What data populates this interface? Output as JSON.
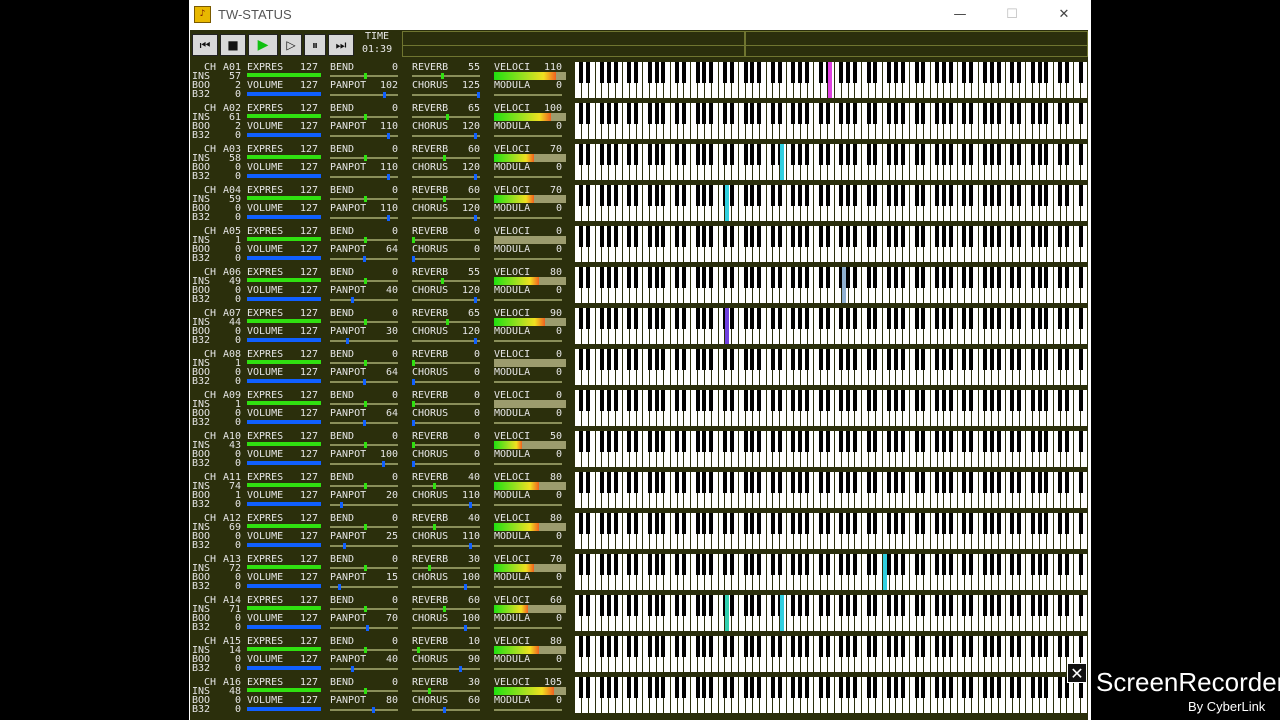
{
  "window": {
    "title": "TW-STATUS",
    "icon": "tw-app-icon",
    "minimize": "—",
    "maximize": "☐",
    "close": "✕"
  },
  "toolbar": {
    "buttons": [
      {
        "name": "skip-back-button",
        "icon": "skip-back-icon",
        "label": "⏮"
      },
      {
        "name": "stop-button",
        "icon": "stop-icon",
        "label": "■"
      },
      {
        "name": "play-button",
        "icon": "play-icon",
        "label": "▶"
      },
      {
        "name": "step-forward-button",
        "icon": "step-forward-icon",
        "label": "▷"
      },
      {
        "name": "pause-button",
        "icon": "pause-icon",
        "label": "⏸"
      },
      {
        "name": "skip-forward-button",
        "icon": "skip-forward-icon",
        "label": "⏭"
      }
    ],
    "time_label": "TIME",
    "time_value": "01:39"
  },
  "labels": {
    "ch": "CH",
    "ins": "INS",
    "boo": "BOO",
    "b32": "B32",
    "expres": "EXPRES",
    "volume": "VOLUME",
    "bend": "BEND",
    "panpot": "PANPOT",
    "reverb": "REVERB",
    "chorus": "CHORUS",
    "veloci": "VELOCI",
    "modula": "MODULA"
  },
  "colors": {
    "panel": "#2b2f0c",
    "green_bar": "#30e010",
    "blue_bar": "#1060ff"
  },
  "channels": [
    {
      "ch": "A01",
      "ins": "57",
      "boo": "2",
      "b32": "0",
      "expres": "127",
      "volume": "127",
      "bend": "0",
      "panpot": "102",
      "reverb": "55",
      "chorus": "125",
      "veloci": "110",
      "modula": "0",
      "notes": [
        {
          "k": 37,
          "c": "#e040e0"
        }
      ]
    },
    {
      "ch": "A02",
      "ins": "61",
      "boo": "2",
      "b32": "0",
      "expres": "127",
      "volume": "127",
      "bend": "0",
      "panpot": "110",
      "reverb": "65",
      "chorus": "120",
      "veloci": "100",
      "modula": "0",
      "notes": []
    },
    {
      "ch": "A03",
      "ins": "58",
      "boo": "0",
      "b32": "0",
      "expres": "127",
      "volume": "127",
      "bend": "0",
      "panpot": "110",
      "reverb": "60",
      "chorus": "120",
      "veloci": "70",
      "modula": "0",
      "notes": [
        {
          "k": 30,
          "c": "#30d0e0"
        }
      ]
    },
    {
      "ch": "A04",
      "ins": "59",
      "boo": "0",
      "b32": "0",
      "expres": "127",
      "volume": "127",
      "bend": "0",
      "panpot": "110",
      "reverb": "60",
      "chorus": "120",
      "veloci": "70",
      "modula": "0",
      "notes": [
        {
          "k": 22,
          "c": "#30d0e0"
        }
      ]
    },
    {
      "ch": "A05",
      "ins": "1",
      "boo": "0",
      "b32": "0",
      "expres": "127",
      "volume": "127",
      "bend": "0",
      "panpot": "64",
      "reverb": "0",
      "chorus": "0",
      "veloci": "0",
      "modula": "0",
      "notes": []
    },
    {
      "ch": "A06",
      "ins": "49",
      "boo": "0",
      "b32": "0",
      "expres": "127",
      "volume": "127",
      "bend": "0",
      "panpot": "40",
      "reverb": "55",
      "chorus": "120",
      "veloci": "80",
      "modula": "0",
      "notes": [
        {
          "k": 39,
          "c": "#8fb0d0"
        }
      ]
    },
    {
      "ch": "A07",
      "ins": "44",
      "boo": "0",
      "b32": "0",
      "expres": "127",
      "volume": "127",
      "bend": "0",
      "panpot": "30",
      "reverb": "65",
      "chorus": "120",
      "veloci": "90",
      "modula": "0",
      "notes": [
        {
          "k": 22,
          "c": "#7040e0"
        }
      ]
    },
    {
      "ch": "A08",
      "ins": "1",
      "boo": "0",
      "b32": "0",
      "expres": "127",
      "volume": "127",
      "bend": "0",
      "panpot": "64",
      "reverb": "0",
      "chorus": "0",
      "veloci": "0",
      "modula": "0",
      "notes": []
    },
    {
      "ch": "A09",
      "ins": "1",
      "boo": "0",
      "b32": "0",
      "expres": "127",
      "volume": "127",
      "bend": "0",
      "panpot": "64",
      "reverb": "0",
      "chorus": "0",
      "veloci": "0",
      "modula": "0",
      "notes": []
    },
    {
      "ch": "A10",
      "ins": "43",
      "boo": "0",
      "b32": "0",
      "expres": "127",
      "volume": "127",
      "bend": "0",
      "panpot": "100",
      "reverb": "0",
      "chorus": "0",
      "veloci": "50",
      "modula": "0",
      "notes": []
    },
    {
      "ch": "A11",
      "ins": "74",
      "boo": "1",
      "b32": "0",
      "expres": "127",
      "volume": "127",
      "bend": "0",
      "panpot": "20",
      "reverb": "40",
      "chorus": "110",
      "veloci": "80",
      "modula": "0",
      "notes": []
    },
    {
      "ch": "A12",
      "ins": "69",
      "boo": "0",
      "b32": "0",
      "expres": "127",
      "volume": "127",
      "bend": "0",
      "panpot": "25",
      "reverb": "40",
      "chorus": "110",
      "veloci": "80",
      "modula": "0",
      "notes": []
    },
    {
      "ch": "A13",
      "ins": "72",
      "boo": "0",
      "b32": "0",
      "expres": "127",
      "volume": "127",
      "bend": "0",
      "panpot": "15",
      "reverb": "30",
      "chorus": "100",
      "veloci": "70",
      "modula": "0",
      "notes": [
        {
          "k": 45,
          "c": "#30d0e0"
        }
      ]
    },
    {
      "ch": "A14",
      "ins": "71",
      "boo": "0",
      "b32": "0",
      "expres": "127",
      "volume": "127",
      "bend": "0",
      "panpot": "70",
      "reverb": "60",
      "chorus": "100",
      "veloci": "60",
      "modula": "0",
      "notes": [
        {
          "k": 22,
          "c": "#30d0b0"
        },
        {
          "k": 30,
          "c": "#30d0e0"
        }
      ]
    },
    {
      "ch": "A15",
      "ins": "14",
      "boo": "0",
      "b32": "0",
      "expres": "127",
      "volume": "127",
      "bend": "0",
      "panpot": "40",
      "reverb": "10",
      "chorus": "90",
      "veloci": "80",
      "modula": "0",
      "notes": []
    },
    {
      "ch": "A16",
      "ins": "48",
      "boo": "0",
      "b32": "0",
      "expres": "127",
      "volume": "127",
      "bend": "0",
      "panpot": "80",
      "reverb": "30",
      "chorus": "60",
      "veloci": "105",
      "modula": "0",
      "notes": []
    }
  ],
  "recorder": {
    "title": "ScreenRecorder",
    "subtitle": "By CyberLink",
    "close": "✕"
  }
}
